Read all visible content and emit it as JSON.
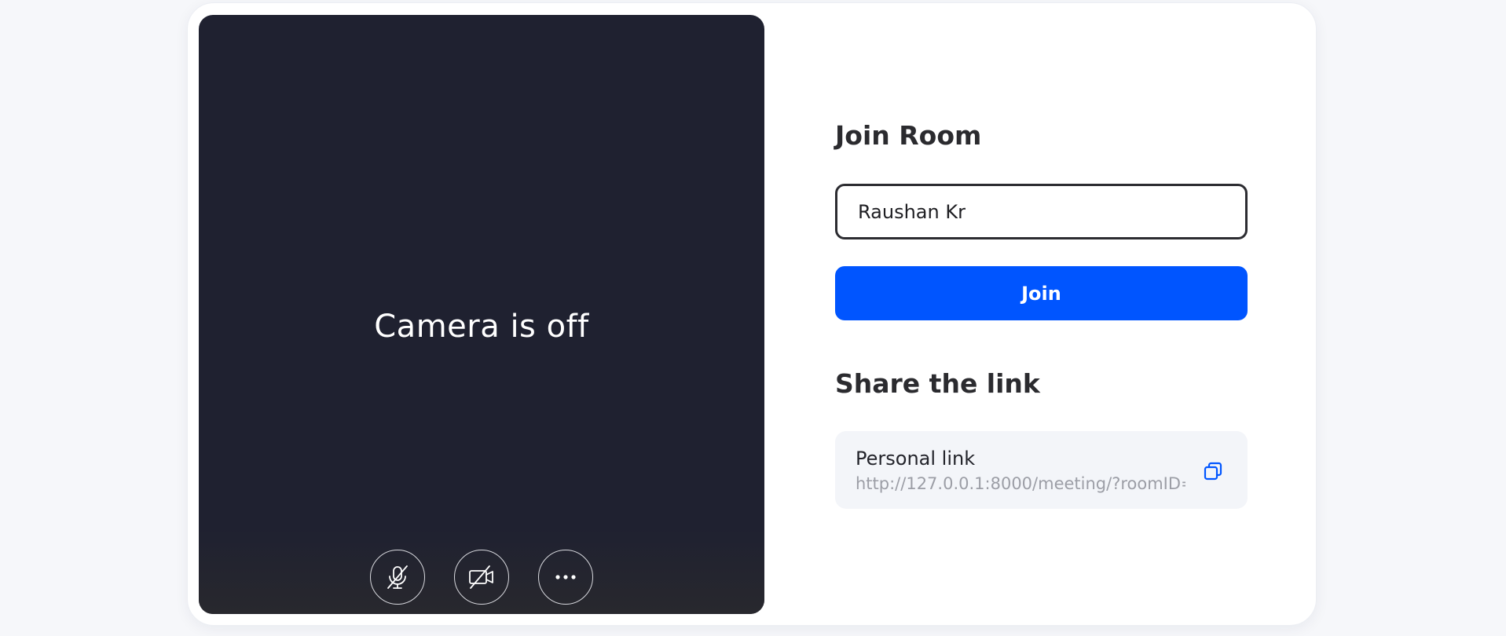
{
  "preview": {
    "status_text": "Camera is off",
    "controls": [
      {
        "icon": "mic-off-icon",
        "label": "Mute microphone"
      },
      {
        "icon": "camera-off-icon",
        "label": "Turn camera on"
      },
      {
        "icon": "more-options-icon",
        "label": "More options"
      }
    ]
  },
  "join": {
    "title": "Join Room",
    "name_value": "Raushan Kr",
    "button_label": "Join"
  },
  "share": {
    "title": "Share the link",
    "link_label": "Personal link",
    "link_url": "http://127.0.0.1:8000/meeting/?roomID=",
    "copy_icon": "copy-icon"
  },
  "colors": {
    "accent": "#0055ff",
    "preview_bg": "#1f2130",
    "link_box_bg": "#f3f5f9"
  }
}
